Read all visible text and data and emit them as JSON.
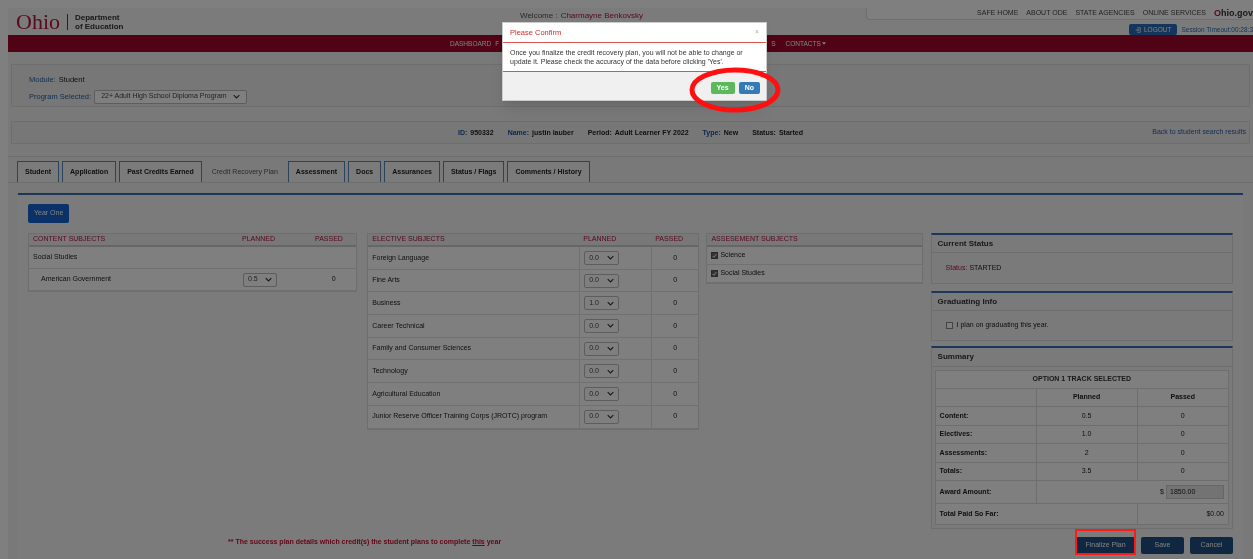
{
  "header": {
    "logo": {
      "wordmark": "Ohio",
      "department": "Department",
      "subtitle": "of Education"
    },
    "welcome_label": "Welcome :",
    "user_name": "Charmayne Benkovsky",
    "top_links": [
      "SAFE HOME",
      "ABOUT ODE",
      "STATE AGENCIES",
      "ONLINE SERVICES"
    ],
    "portal": "Ohio.gov",
    "logout": "LOGOUT",
    "session_timeout": "Session Timeout:00:28:3"
  },
  "nav": [
    {
      "label": "DASHBOARD",
      "dropdown": false
    },
    {
      "label": "F",
      "dropdown": false
    },
    {
      "label": "S",
      "dropdown": false
    },
    {
      "label": "CONTACTS",
      "dropdown": true
    }
  ],
  "module": {
    "label": "Module:",
    "value": "Student"
  },
  "program": {
    "label": "Program Selected:",
    "value": "22+ Adult High School Diploma Program"
  },
  "student_info": [
    {
      "label": "ID:",
      "value": "950332",
      "kind": "accent"
    },
    {
      "label": "Name:",
      "value": "justin  lauber",
      "kind": "accent"
    },
    {
      "label": "Period:",
      "value": "Adult Learner FY 2022",
      "kind": "plain"
    },
    {
      "label": "Type:",
      "value": "New",
      "kind": "accent"
    },
    {
      "label": "Status:",
      "value": "Started",
      "kind": "plain"
    }
  ],
  "back_link": "Back to student search results",
  "tabs": [
    {
      "label": "Student",
      "selected": false
    },
    {
      "label": "Application",
      "selected": false
    },
    {
      "label": "Past Credits Earned",
      "selected": false
    },
    {
      "label": "Credit Recovery Plan",
      "selected": true
    },
    {
      "label": "Assessment",
      "selected": false
    },
    {
      "label": "Docs",
      "selected": false
    },
    {
      "label": "Assurances",
      "selected": false
    },
    {
      "label": "Status / Flags",
      "selected": false
    },
    {
      "label": "Comments / History",
      "selected": false
    }
  ],
  "year_button": "Year One",
  "content_table": {
    "columns": [
      "CONTENT SUBJECTS",
      "PLANNED",
      "PASSED"
    ],
    "rows": [
      {
        "kind": "group",
        "subject": "Social Studies"
      },
      {
        "kind": "course",
        "subject": "American Government",
        "planned": "0.5",
        "passed": "0"
      }
    ]
  },
  "elective_table": {
    "columns": [
      "ELECTIVE SUBJECTS",
      "PLANNED",
      "PASSED"
    ],
    "rows": [
      {
        "subject": "Foreign Language",
        "planned": "0.0",
        "passed": "0"
      },
      {
        "subject": "Fine Arts",
        "planned": "0.0",
        "passed": "0"
      },
      {
        "subject": "Business",
        "planned": "1.0",
        "passed": "0"
      },
      {
        "subject": "Career Technical",
        "planned": "0.0",
        "passed": "0"
      },
      {
        "subject": "Family and Consumer Sciences",
        "planned": "0.0",
        "passed": "0"
      },
      {
        "subject": "Technology",
        "planned": "0.0",
        "passed": "0"
      },
      {
        "subject": "Agricultural Education",
        "planned": "0.0",
        "passed": "0"
      },
      {
        "subject": "Junior Reserve Officer Training Corps (JROTC) program",
        "planned": "0.0",
        "passed": "0"
      }
    ]
  },
  "assessment": {
    "title": "ASSESEMENT SUBJECTS",
    "items": [
      {
        "label": "Science",
        "checked": true
      },
      {
        "label": "Social Studies",
        "checked": true
      }
    ]
  },
  "current_status": {
    "title": "Current Status",
    "label": "Status:",
    "value": "STARTED"
  },
  "graduating": {
    "title": "Graduating Info",
    "label": "I plan on graduating this year.",
    "checked": false
  },
  "summary": {
    "title": "Summary",
    "track": "OPTION 1 TRACK SELECTED",
    "columns": [
      "Planned",
      "Passed"
    ],
    "rows": [
      {
        "label": "Content:",
        "planned": "0.5",
        "passed": "0"
      },
      {
        "label": "Electives:",
        "planned": "1.0",
        "passed": "0"
      },
      {
        "label": "Assessments:",
        "planned": "2",
        "passed": "0"
      },
      {
        "label": "Totals:",
        "planned": "3.5",
        "passed": "0"
      }
    ],
    "award": {
      "label": "Award Amount:",
      "currency": "$",
      "value": "1850.00"
    },
    "paid": {
      "label": "Total Paid So Far:",
      "value": "$0.00"
    }
  },
  "footnote": {
    "before": "** The success plan details which credit(s) the student plans to complete",
    "underlined": "this",
    "after": "year"
  },
  "actions": [
    {
      "label": "Finalize Plan",
      "highlighted": true
    },
    {
      "label": "Save",
      "highlighted": false
    },
    {
      "label": "Cancel",
      "highlighted": false
    }
  ],
  "modal": {
    "title": "Please Confirm",
    "close": "×",
    "message": "Once you finalize the credit recovery plan, you will not be able to change or update it. Please check the accuracy of the data before clicking 'Yes'.",
    "buttons": [
      {
        "label": "Yes",
        "kind": "confirm"
      },
      {
        "label": "No",
        "kind": "cancel"
      }
    ],
    "annotated": true
  }
}
